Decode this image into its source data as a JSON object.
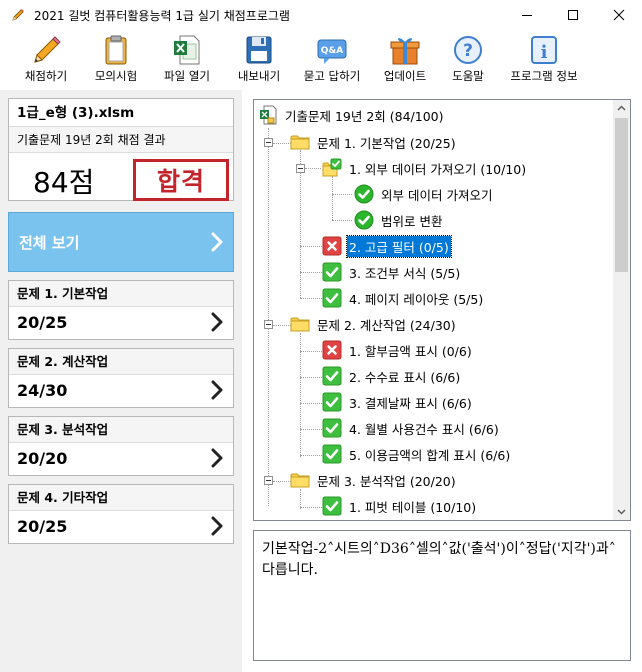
{
  "window": {
    "title": "2021 길벗 컴퓨터활용능력 1급 실기 채점프로그램"
  },
  "toolbar": [
    {
      "label": "채점하기",
      "icon": "pencil-icon"
    },
    {
      "label": "모의시험",
      "icon": "clipboard-icon"
    },
    {
      "label": "파일 열기",
      "icon": "excel-file-icon"
    },
    {
      "label": "내보내기",
      "icon": "floppy-disk-icon"
    },
    {
      "label": "묻고 답하기",
      "icon": "qa-icon"
    },
    {
      "label": "업데이트",
      "icon": "gift-icon"
    },
    {
      "label": "도움말",
      "icon": "help-icon"
    },
    {
      "label": "프로그램 정보",
      "icon": "info-icon"
    }
  ],
  "file": {
    "name": "1급_e형 (3).xlsm",
    "subtitle": "기출문제 19년 2회 채점 결과",
    "score": "84점",
    "stamp": "합격"
  },
  "all_view": {
    "label": "전체 보기"
  },
  "sections": [
    {
      "title": "문제 1. 기본작업",
      "score": "20/25"
    },
    {
      "title": "문제 2. 계산작업",
      "score": "24/30"
    },
    {
      "title": "문제 3. 분석작업",
      "score": "20/20"
    },
    {
      "title": "문제 4. 기타작업",
      "score": "20/25"
    }
  ],
  "tree": {
    "root": "기출문제 19년 2회 (84/100)",
    "nodes": [
      {
        "text": "문제 1. 기본작업 (20/25)",
        "icon": "folder-icon"
      },
      {
        "text": "1. 외부 데이터 가져오기 (10/10)",
        "icon": "folder-check-icon"
      },
      {
        "text": "외부 데이터 가져오기",
        "icon": "check-circle-icon"
      },
      {
        "text": "범위로 변환",
        "icon": "check-circle-icon"
      },
      {
        "text": "2. 고급 필터 (0/5)",
        "icon": "error-icon"
      },
      {
        "text": "3. 조건부 서식 (5/5)",
        "icon": "check-icon"
      },
      {
        "text": "4. 페이지 레이아웃 (5/5)",
        "icon": "check-icon"
      },
      {
        "text": "문제 2. 계산작업 (24/30)",
        "icon": "folder-icon"
      },
      {
        "text": "1. 할부금액 표시 (0/6)",
        "icon": "error-icon"
      },
      {
        "text": "2. 수수료 표시 (6/6)",
        "icon": "check-icon"
      },
      {
        "text": "3. 결제날짜 표시 (6/6)",
        "icon": "check-icon"
      },
      {
        "text": "4. 월별 사용건수 표시 (6/6)",
        "icon": "check-icon"
      },
      {
        "text": "5. 이용금액의 합계 표시 (6/6)",
        "icon": "check-icon"
      },
      {
        "text": "문제 3. 분석작업 (20/20)",
        "icon": "folder-icon"
      },
      {
        "text": "1. 피벗 테이블 (10/10)",
        "icon": "check-icon"
      }
    ]
  },
  "message": "기본작업-2˄시트의˄D36˄셀의˄값('출석')이˄정답('지각')과˄다릅니다.",
  "colors": {
    "accent": "#7bc3ef",
    "selection": "#0078d7",
    "stamp": "#c3242a",
    "success": "#2db52d",
    "error": "#e04343"
  }
}
